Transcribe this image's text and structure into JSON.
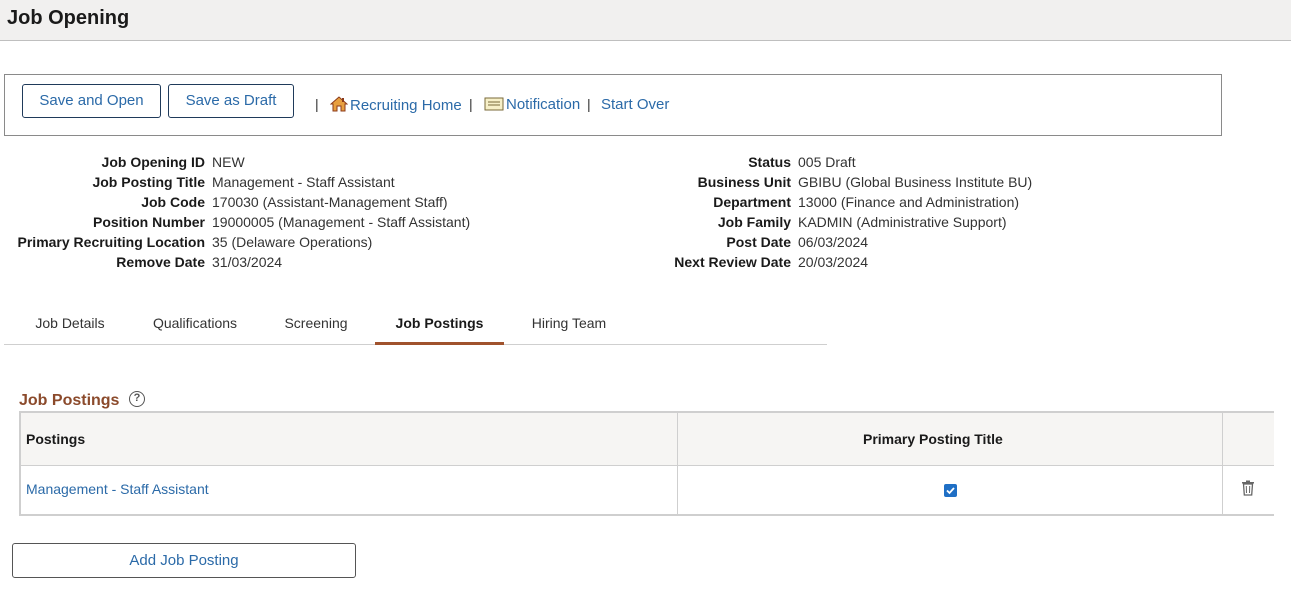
{
  "page": {
    "title": "Job Opening"
  },
  "toolbar": {
    "save_open_label": "Save and Open",
    "save_draft_label": "Save as Draft",
    "separator": "|",
    "recruiting_home_label": "Recruiting Home",
    "notification_label": "Notification",
    "start_over_label": "Start Over"
  },
  "fields_left": [
    {
      "label": "Job Opening ID",
      "value": "NEW"
    },
    {
      "label": "Job Posting Title",
      "value": "Management - Staff Assistant"
    },
    {
      "label": "Job Code",
      "value": "170030 (Assistant-Management Staff)"
    },
    {
      "label": "Position Number",
      "value": "19000005 (Management - Staff Assistant)"
    },
    {
      "label": "Primary Recruiting Location",
      "value": "35 (Delaware Operations)"
    },
    {
      "label": "Remove Date",
      "value": "31/03/2024"
    }
  ],
  "fields_right": [
    {
      "label": "Status",
      "value": "005 Draft"
    },
    {
      "label": "Business Unit",
      "value": "GBIBU (Global Business Institute BU)"
    },
    {
      "label": "Department",
      "value": "13000 (Finance and Administration)"
    },
    {
      "label": "Job Family",
      "value": "KADMIN (Administrative Support)"
    },
    {
      "label": "Post Date",
      "value": "06/03/2024"
    },
    {
      "label": "Next Review Date",
      "value": "20/03/2024"
    }
  ],
  "tabs": [
    {
      "label": "Job Details"
    },
    {
      "label": "Qualifications"
    },
    {
      "label": "Screening"
    },
    {
      "label": "Job Postings",
      "active": true
    },
    {
      "label": "Hiring Team"
    }
  ],
  "section": {
    "title": "Job Postings",
    "help_symbol": "?"
  },
  "grid": {
    "headers": {
      "postings": "Postings",
      "primary": "Primary Posting Title"
    },
    "rows": [
      {
        "posting": "Management - Staff Assistant",
        "primary_checked": true
      }
    ]
  },
  "add_button_label": "Add Job Posting",
  "colors": {
    "link": "#2b6aa8",
    "section_title": "#8b4a2b",
    "active_tab_underline": "#a0522d",
    "checkbox": "#1f6fc5",
    "header_bg": "#f1f0ef"
  }
}
